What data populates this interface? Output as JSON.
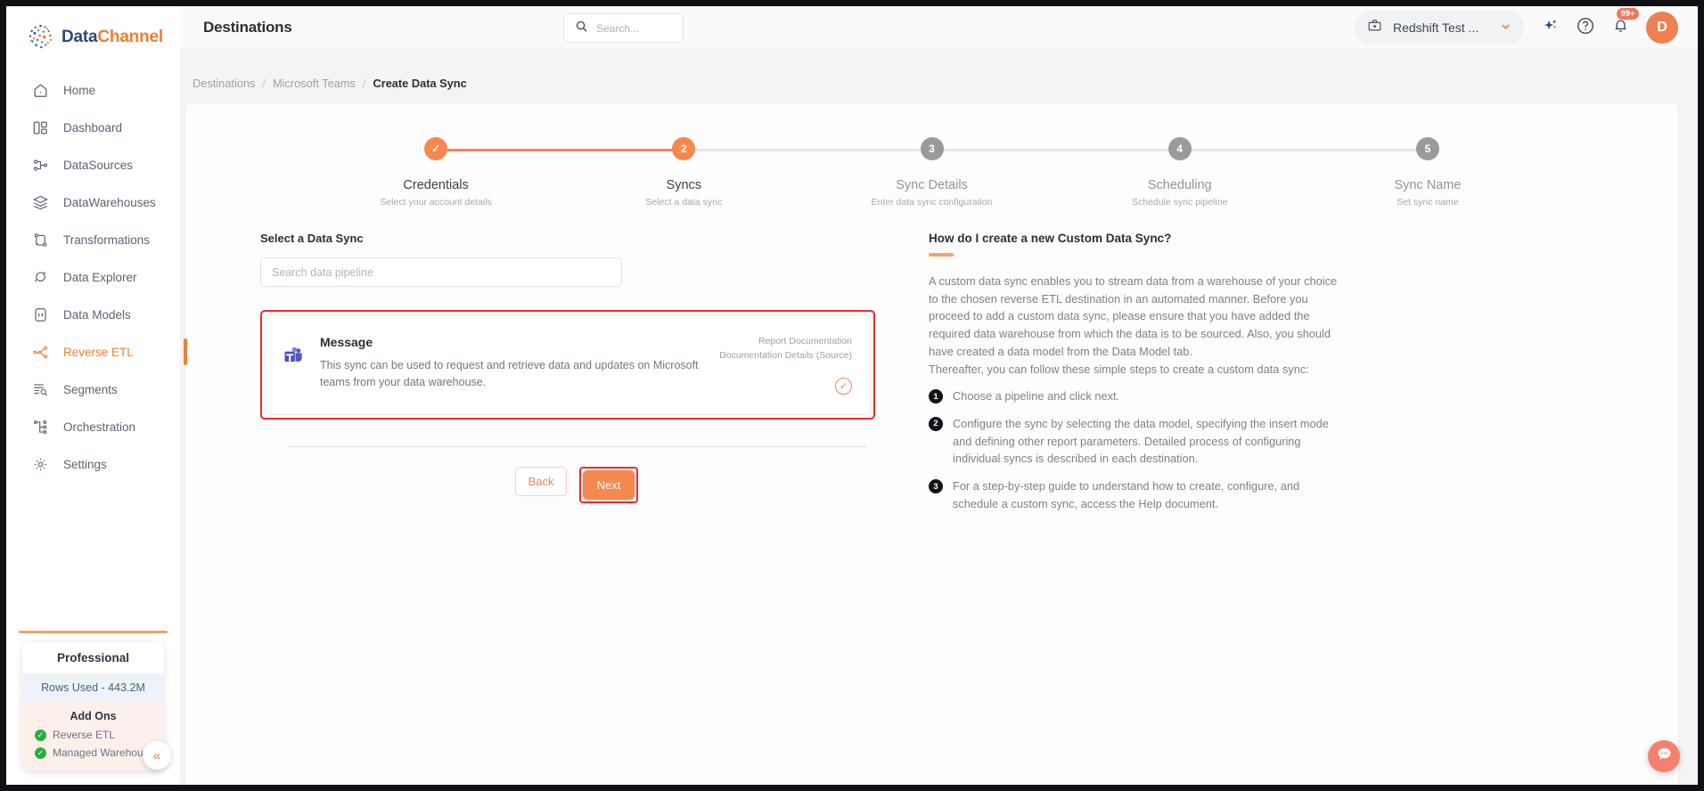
{
  "brand": {
    "name_part1": "Data",
    "name_part2": "Channel",
    "logo_icon": "datachannel-globe-logo"
  },
  "sidebar": {
    "items": [
      {
        "label": "Home",
        "icon": "home-icon",
        "active": false
      },
      {
        "label": "Dashboard",
        "icon": "dashboard-icon",
        "active": false
      },
      {
        "label": "DataSources",
        "icon": "datasources-icon",
        "active": false
      },
      {
        "label": "DataWarehouses",
        "icon": "datawarehouses-icon",
        "active": false
      },
      {
        "label": "Transformations",
        "icon": "transformations-icon",
        "active": false
      },
      {
        "label": "Data Explorer",
        "icon": "data-explorer-icon",
        "active": false
      },
      {
        "label": "Data Models",
        "icon": "data-models-icon",
        "active": false
      },
      {
        "label": "Reverse ETL",
        "icon": "reverse-etl-icon",
        "active": true
      },
      {
        "label": "Segments",
        "icon": "segments-icon",
        "active": false
      },
      {
        "label": "Orchestration",
        "icon": "orchestration-icon",
        "active": false
      },
      {
        "label": "Settings",
        "icon": "gear-icon",
        "active": false
      }
    ],
    "plan": {
      "title": "Professional",
      "rows_used": "Rows Used - 443.2M",
      "addons_heading": "Add Ons",
      "addons": [
        {
          "label": "Reverse ETL",
          "icon": "check-circle-icon"
        },
        {
          "label": "Managed Warehouse",
          "icon": "check-circle-icon"
        }
      ]
    },
    "collapse_icon": "double-chevron-left-icon"
  },
  "header": {
    "title": "Destinations",
    "search": {
      "placeholder": "Search...",
      "value": "",
      "icon": "search-icon"
    },
    "workspace": {
      "label": "Redshift Test ...",
      "icon": "briefcase-icon",
      "chevron": "chevron-down-icon"
    },
    "ai_icon": "sparkle-icon",
    "help_icon": "question-circle-icon",
    "notifications": {
      "icon": "bell-icon",
      "badge": "99+"
    },
    "avatar": {
      "initial": "D"
    }
  },
  "breadcrumb": {
    "items": [
      {
        "label": "Destinations",
        "current": false
      },
      {
        "label": "Microsoft Teams",
        "current": false
      },
      {
        "label": "Create Data Sync",
        "current": true
      }
    ],
    "separator": "/"
  },
  "stepper": {
    "steps": [
      {
        "num": "1",
        "marker": "✓",
        "title": "Credentials",
        "subtitle": "Select your account details",
        "state": "done"
      },
      {
        "num": "2",
        "marker": "2",
        "title": "Syncs",
        "subtitle": "Select a data sync",
        "state": "current"
      },
      {
        "num": "3",
        "marker": "3",
        "title": "Sync Details",
        "subtitle": "Enter data sync configuration",
        "state": "upcoming"
      },
      {
        "num": "4",
        "marker": "4",
        "title": "Scheduling",
        "subtitle": "Schedule sync pipeline",
        "state": "upcoming"
      },
      {
        "num": "5",
        "marker": "5",
        "title": "Sync Name",
        "subtitle": "Set sync name",
        "state": "upcoming"
      }
    ]
  },
  "main": {
    "section_label": "Select a Data Sync",
    "pipeline_search": {
      "placeholder": "Search data pipeline",
      "value": ""
    },
    "sync_card": {
      "icon": "microsoft-teams-icon",
      "title": "Message",
      "description": "This sync can be used to request and retrieve data and updates on Microsoft teams from your data warehouse.",
      "doc_line1": "Report Documentation",
      "doc_line2": "Documentation Details (Source)",
      "selected_icon": "check-circle-outline-icon"
    },
    "buttons": {
      "back": "Back",
      "next": "Next"
    }
  },
  "help": {
    "heading": "How do I create a new Custom Data Sync?",
    "paragraph": "A custom data sync enables you to stream data from a warehouse of your choice to the chosen reverse ETL destination in an automated manner. Before you proceed to add a custom data sync, please ensure that you have added the required data warehouse from which the data is to be sourced. Also, you should have created a data model from the Data Model tab.",
    "paragraph2": "Thereafter, you can follow these simple steps to create a custom data sync:",
    "steps": [
      {
        "num": "1",
        "text": "Choose a pipeline and click next."
      },
      {
        "num": "2",
        "text": "Configure the sync by selecting the data model, specifying the insert mode and defining other report parameters. Detailed process of configuring individual syncs is described in each destination."
      },
      {
        "num": "3",
        "text": "For a step-by-step guide to understand how to create, configure, and schedule a custom sync, access the Help document."
      }
    ]
  },
  "chat": {
    "icon": "chat-bubble-icon"
  },
  "colors": {
    "accent": "#f0802f",
    "accent_soft": "#f5884f",
    "highlight_border": "#ef2b2b",
    "brand_blue": "#2b4a7e",
    "step_inactive": "#9a9a9a",
    "success_green": "#27ae43"
  }
}
